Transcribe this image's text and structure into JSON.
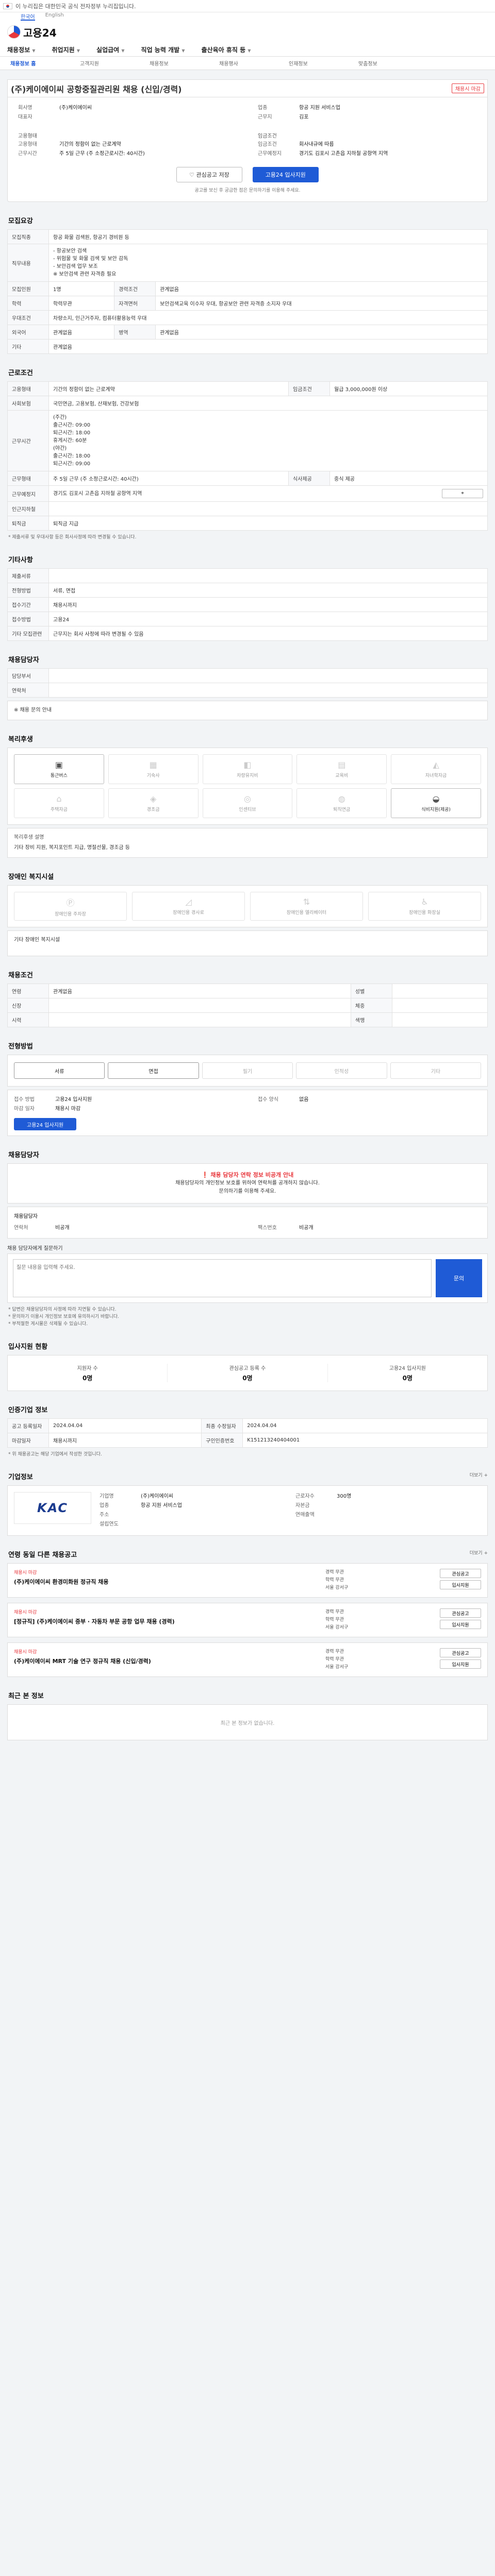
{
  "notice": "이 누리집은 대한민국 공식 전자정부 누리집입니다.",
  "lang": [
    "한국어",
    "English"
  ],
  "logo": "고용24",
  "gnb": [
    "채용정보",
    "취업지원",
    "실업급여",
    "직업 능력 개발",
    "출산육아 휴직 등"
  ],
  "subtabs": [
    "채용정보 홈",
    "고객지원",
    "채용정보",
    "채용행사",
    "인재정보",
    "맞춤정보"
  ],
  "title": "(주)케이에이씨 공항중질관리원 채용 (신입/경력)",
  "status_badge": "채용시 마감",
  "company": {
    "name_k": "회사명",
    "name_v": "(주)케이에이씨",
    "rep_k": "대표자",
    "rep_v": "",
    "biz_k": "업종",
    "biz_v": "항공 지원 서비스업",
    "addr_k": "근무지",
    "addr_v": "김포",
    "wage_head": "고용형태",
    "form_k": "고용형태",
    "form_v": "기간의 정함이 없는 근로계약",
    "hours_k": "근무시간",
    "hours_v": "주 5일 근무 (주 소정근로시간: 40시간)",
    "pay_head": "임금조건",
    "pay_k": "임금조건",
    "pay_v": "회사내규에 따름",
    "place_k": "근무예정지",
    "place_v": "경기도 김포시 고촌읍 지하철 공항역 지역"
  },
  "actions": {
    "save": "관심공고 저장",
    "apply": "고용24 입사지원"
  },
  "action_note": "공고를 보신 후 궁금한 점은 문의하기를 이용해 주세요.",
  "sec_recruit": "모집요강",
  "recruit": {
    "job_k": "모집직종",
    "job_v": "항공 화물 검색원, 항공기 경비원 등",
    "desc_k": "직무내용",
    "desc_lines": [
      "- 항공보안 검색",
      "- 위험물 및 화물 검색 및 보안 감독",
      "- 보안검색 업무 보조",
      "※ 보안검색 관련 자격증 필요"
    ],
    "cnt_k": "모집인원",
    "cnt_v": "1명",
    "career_k": "경력조건",
    "career_v": "관계없음",
    "edu_k": "학력",
    "edu_v": "학력무관",
    "cert_k": "자격면허",
    "cert_v": "보안검색교육 이수자 우대, 항공보안 관련 자격증 소지자 우대",
    "pref_k": "우대조건",
    "pref_v": "차량소지, 인근거주자, 컴퓨터활용능력 우대",
    "lang_k": "외국어",
    "lang_v": "관계없음",
    "mil_k": "병역",
    "mil_v": "관계없음",
    "etc_k": "기타",
    "etc_v": "관계없음"
  },
  "sec_work": "근로조건",
  "work": {
    "type_k": "고용형태",
    "type_v": "기간의 정함이 없는 근로계약",
    "wage_k": "임금조건",
    "wage_v": "월급 3,000,000원 이상",
    "ins_k": "사회보험",
    "ins_v": "국민연금, 고용보험, 산재보험, 건강보험",
    "time_k": "근무시간",
    "time_lines": [
      "(주간)",
      "출근시간: 09:00",
      "퇴근시간: 18:00",
      "휴게시간: 60분",
      "(야간)",
      "출근시간: 18:00",
      "퇴근시간: 09:00"
    ],
    "week_k": "근무형태",
    "week_v": "주 5일 근무 (주 소정근로시간: 40시간)",
    "meal_k": "식사제공",
    "meal_v": "중식 제공",
    "place_k": "근무예정지",
    "place_v": "경기도 김포시 고촌읍 지하철 공항역 지역",
    "station_k": "인근지하철",
    "station_v": "",
    "severance_k": "퇴직금",
    "severance_v": "퇴직금 지급"
  },
  "work_note": "* 제출서류 및 우대사항 등은 회사사정에 따라 변경될 수 있습니다.",
  "sec_etc": "기타사항",
  "etc": {
    "doc_k": "제출서류",
    "doc_v": "",
    "method_k": "전형방법",
    "method_v": "서류, 면접",
    "period_k": "접수기간",
    "period_v": "채용시까지",
    "apply_k": "접수방법",
    "apply_v": "고용24",
    "misc_k": "기타 모집관련",
    "misc_v": "근무지는 회사 사정에 따라 변경될 수 있음"
  },
  "sec_recruiter": "채용담당자",
  "recruiter": {
    "dept_k": "담당부서",
    "dept_v": "",
    "tel_k": "연락처",
    "tel_v": "",
    "tip": "※ 채용 문의 안내"
  },
  "sec_facility": "복리후생",
  "facility": [
    "통근버스",
    "기숙사",
    "차량유지비",
    "교육비",
    "자녀학자금",
    "주택자금",
    "경조금",
    "인센티브",
    "퇴직연금",
    "식비지원(제공)"
  ],
  "facility_note_k": "복리후생 설명",
  "facility_note": "기타 장비 지원, 복지포인트 지급, 명절선물, 경조금 등",
  "sec_disability": "장애인 복지시설",
  "disability": [
    "장애인용 주차장",
    "장애인용 경사로",
    "장애인용 엘리베이터",
    "장애인용 화장실"
  ],
  "disability_note_k": "기타 장애인 복지시설",
  "sec_condition": "채용조건",
  "condition": {
    "age_k": "연령",
    "age_v": "관계없음",
    "gender_k": "성별",
    "gender_v": "",
    "height_k": "신장",
    "height_v": "",
    "weight_k": "체중",
    "weight_v": "",
    "eye_k": "시력",
    "eye_v": "",
    "color_k": "색맹",
    "color_v": ""
  },
  "sec_process": "전형방법",
  "process": [
    "서류",
    "면접",
    "필기",
    "인적성",
    "기타"
  ],
  "apply_box": {
    "way_k": "접수 방법",
    "way_v": "고용24 입사지원",
    "form_k": "접수 양식",
    "form_v": "없음",
    "period_k": "마감 일자",
    "period_v": "채용시 마감"
  },
  "apply_btn": "고용24 입사지원",
  "warn": {
    "title": "채용 담당자 연락 정보 비공개 안내",
    "line1": "채용담당자의 개인정보 보호를 위하여 연락처를 공개하지 않습니다.",
    "line2": "문의하기를 이용해 주세요.",
    "name_k": "채용담당자",
    "tel_k": "연락처",
    "tel_v": "비공개",
    "fax_k": "팩스번호",
    "fax_v": "비공개"
  },
  "inq": {
    "label": "채용 담당자에게 질문하기",
    "placeholder": "질문 내용을 입력해 주세요.",
    "btn": "문의"
  },
  "bullets": [
    "* 답변은 채용담당자의 사정에 따라 지연될 수 있습니다.",
    "* 문의하기 이용시 개인정보 보호에 유의하시기 바랍니다.",
    "* 부적절한 게시물은 삭제될 수 있습니다."
  ],
  "sec_stats": "입사지원 현황",
  "stats": [
    {
      "k": "지원자 수",
      "v": "0명"
    },
    {
      "k": "관심공고 등록 수",
      "v": "0명"
    },
    {
      "k": "고용24 입사지원",
      "v": "0명"
    }
  ],
  "sec_info": "인증기업 정보",
  "info": {
    "reg_k": "공고 등록일자",
    "reg_v": "2024.04.04",
    "upd_k": "최종 수정일자",
    "upd_v": "2024.04.04",
    "close_k": "마감일자",
    "close_v": "채용시까지",
    "no_k": "구인인증번호",
    "no_v": "K151213240404001"
  },
  "info_note": "* 위 채용공고는 해당 기업에서 작성한 것입니다.",
  "sec_company": "기업정보",
  "kac": "KAC",
  "company_info": {
    "name_k": "기업명",
    "name_v": "(주)케이에이씨",
    "emp_k": "근로자수",
    "emp_v": "300명",
    "biz_k": "업종",
    "biz_v": "항공 지원 서비스업",
    "cap_k": "자본금",
    "cap_v": "",
    "addr_k": "주소",
    "addr_v": "",
    "sales_k": "연매출액",
    "sales_v": "",
    "year_k": "설립연도",
    "year_v": ""
  },
  "sec_similar": "연령 동일 다른 채용공고",
  "similar": [
    {
      "tag": "채용시 마감",
      "title": "(주)케이에이씨 환경미화원 정규직 채용",
      "l1": "경력 무관",
      "l2": "학력 무관",
      "l3": "서울 강서구"
    },
    {
      "tag": "채용시 마감",
      "title": "[정규직] (주)케이에이씨 중부 · 자동차 부문 공항 업무 채용 (경력)",
      "l1": "경력 무관",
      "l2": "학력 무관",
      "l3": "서울 강서구"
    },
    {
      "tag": "채용시 마감",
      "title": "(주)케이에이씨 MRT 기술 연구 정규직 채용 (신입/경력)",
      "l1": "경력 무관",
      "l2": "학력 무관",
      "l3": "서울 강서구"
    }
  ],
  "similar_btn1": "관심공고",
  "similar_btn2": "입사지원",
  "sec_recent": "최근 본 정보",
  "recent_empty": "최근 본 정보가 없습니다.",
  "more": "더보기 +"
}
